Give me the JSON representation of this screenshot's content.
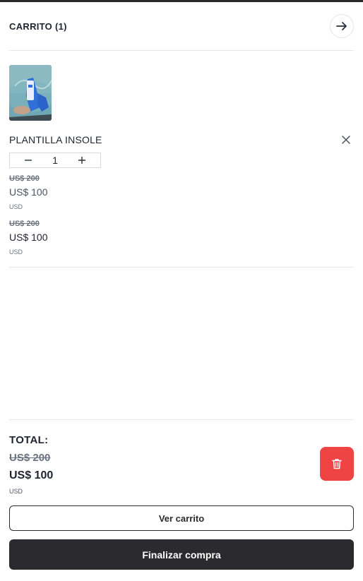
{
  "header": {
    "title": "CARRITO (1)",
    "close_icon": "arrow-right-icon"
  },
  "item": {
    "image_icon": "product-thumbnail",
    "name": "PLANTILLA INSOLE",
    "remove_icon": "close-icon",
    "quantity": "1",
    "decrement_icon": "minus-icon",
    "increment_icon": "plus-icon",
    "unit_price": {
      "original": "US$ 200",
      "current": "US$ 100",
      "currency": "USD"
    },
    "line_total": {
      "original": "US$ 200",
      "current": "US$ 100",
      "currency": "USD"
    }
  },
  "totals": {
    "label": "TOTAL:",
    "original": "US$ 200",
    "current": "US$ 100",
    "currency": "USD",
    "clear_icon": "trash-icon"
  },
  "actions": {
    "view_cart": "Ver carrito",
    "checkout": "Finalizar compra"
  },
  "colors": {
    "accent_dark": "#2b2b2f",
    "danger": "#ee4444",
    "divider": "#e6e7ea"
  }
}
